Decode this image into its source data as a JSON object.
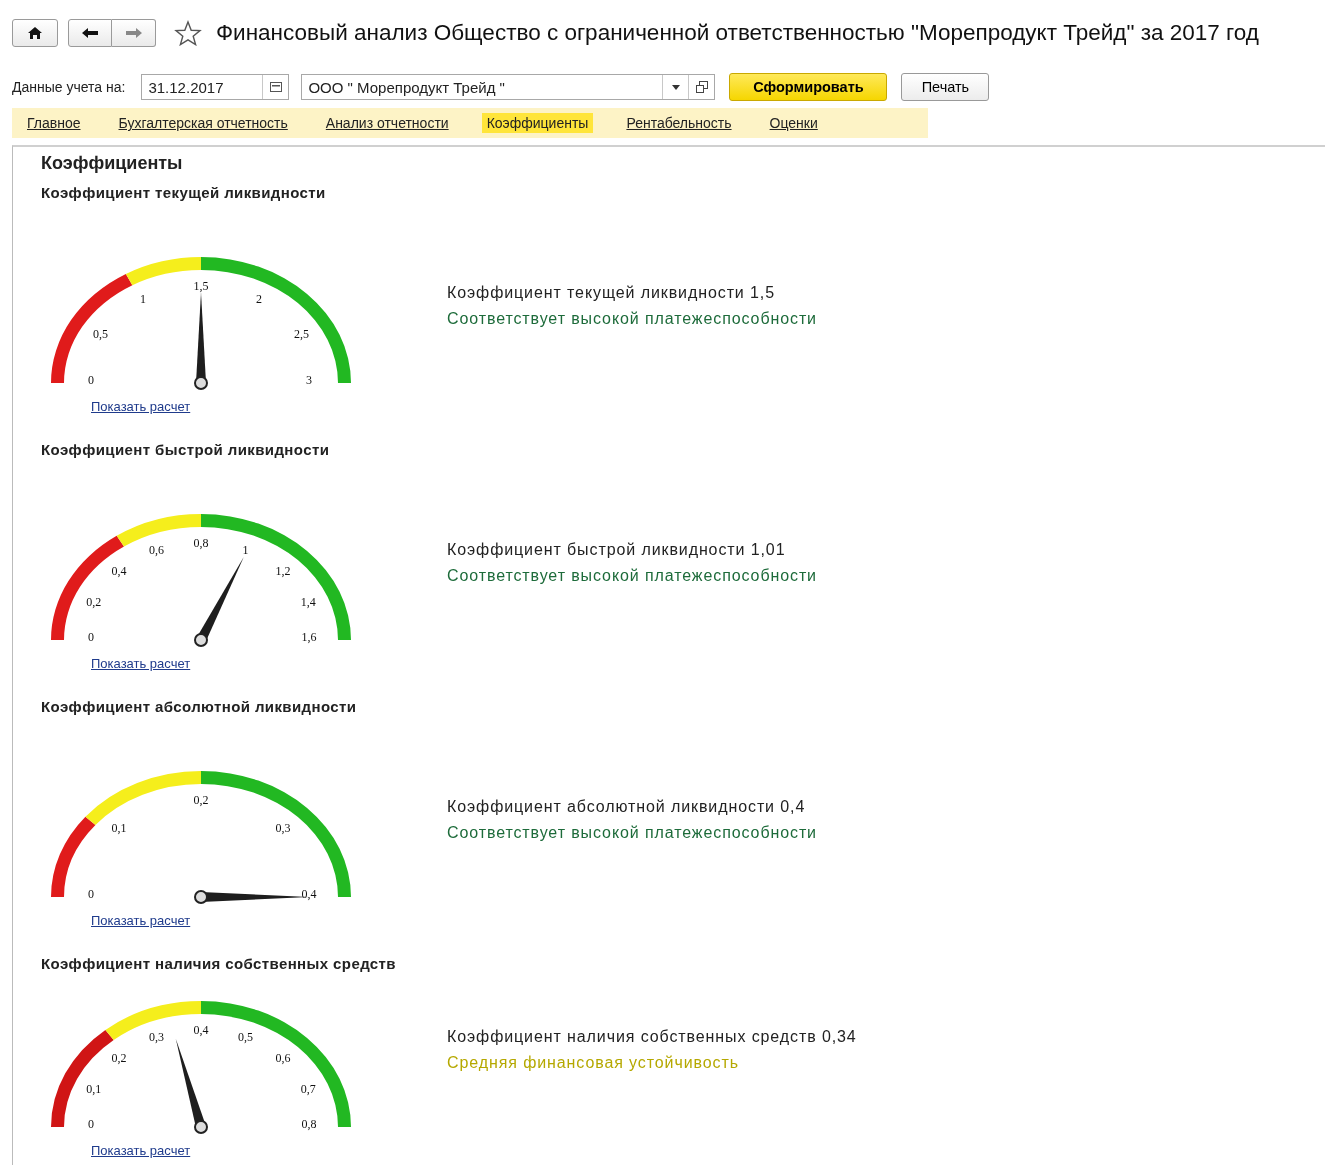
{
  "window": {
    "title": "Финансовый анализ Общество с ограниченной ответственностью \"Морепродукт Трейд\" за 2017 год"
  },
  "toolbar": {
    "date_label": "Данные учета на:",
    "date": "31.12.2017",
    "organization": "ООО \" Морепродукт Трейд \"",
    "buttons": [
      {
        "label": "Сформировать",
        "kind": "primary"
      },
      {
        "label": "Печать",
        "kind": "default"
      }
    ]
  },
  "tabs": [
    {
      "label": "Главное",
      "selected": false
    },
    {
      "label": "Бухгалтерская отчетность",
      "selected": false
    },
    {
      "label": "Анализ отчетности",
      "selected": false
    },
    {
      "label": "Коэффициенты",
      "selected": true
    },
    {
      "label": "Рентабельность",
      "selected": false
    },
    {
      "label": "Оценки",
      "selected": false
    }
  ],
  "section_title": "Коэффициенты",
  "indicators": [
    {
      "title": "Коэффициент текущей ликвидности",
      "ticks": [
        "0",
        "0,5",
        "1",
        "1,5",
        "2",
        "2,5",
        "3"
      ],
      "zones": [
        {
          "color": "#e01b1b"
        },
        {
          "color": "#f5ee1c"
        },
        {
          "color": "#22b822"
        }
      ],
      "link": "Показать расчет",
      "result": "Коэффициент текущей ликвидности 1,5",
      "verdict": {
        "text": "Соответствует высокой платежеспособности",
        "color": "#1d6b3a"
      }
    },
    {
      "title": "Коэффициент быстрой ликвидности",
      "ticks": [
        "0",
        "0,2",
        "0,4",
        "0,6",
        "0,8",
        "1",
        "1,2",
        "1,4",
        "1,6"
      ],
      "zones": [
        {
          "color": "#e01b1b"
        },
        {
          "color": "#f5ee1c"
        },
        {
          "color": "#22b822"
        }
      ],
      "link": "Показать расчет",
      "result": "Коэффициент быстрой ликвидности 1,01",
      "verdict": {
        "text": "Соответствует высокой платежеспособности",
        "color": "#1d6b3a"
      }
    },
    {
      "title": "Коэффициент абсолютной ликвидности",
      "ticks": [
        "0",
        "0,1",
        "0,2",
        "0,3",
        "0,4"
      ],
      "zones": [
        {
          "color": "#e01b1b"
        },
        {
          "color": "#f5ee1c"
        },
        {
          "color": "#22b822"
        }
      ],
      "link": "Показать расчет",
      "result": "Коэффициент абсолютной ликвидности 0,4",
      "verdict": {
        "text": "Соответствует высокой платежеспособности",
        "color": "#1d6b3a"
      }
    },
    {
      "title": "Коэффициент наличия собственных средств",
      "ticks": [
        "0",
        "0,1",
        "0,2",
        "0,3",
        "0,4",
        "0,5",
        "0,6",
        "0,7",
        "0,8"
      ],
      "zones": [
        {
          "color": "#d01515"
        },
        {
          "color": "#f5ee1c"
        },
        {
          "color": "#22b822"
        }
      ],
      "link": "Показать расчет",
      "result": "Коэффициент наличия собственных средств 0,34",
      "verdict": {
        "text": "Средняя финансовая устойчивость",
        "color": "#b5a800"
      }
    }
  ]
}
